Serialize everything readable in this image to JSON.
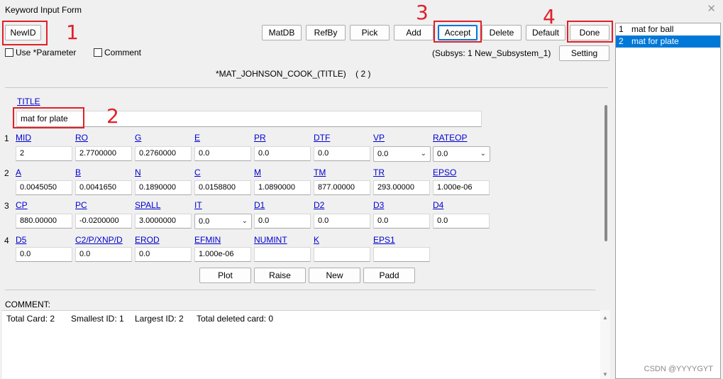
{
  "window": {
    "title": "Keyword Input Form",
    "close": "✕"
  },
  "toolbar": {
    "newid": "NewID",
    "matdb": "MatDB",
    "refby": "RefBy",
    "pick": "Pick",
    "add": "Add",
    "accept": "Accept",
    "delete": "Delete",
    "default": "Default",
    "done": "Done",
    "setting": "Setting"
  },
  "options": {
    "use_parameter": "Use *Parameter",
    "comment": "Comment"
  },
  "subsys": "(Subsys: 1 New_Subsystem_1)",
  "keyword": {
    "name": "*MAT_JOHNSON_COOK_(TITLE)",
    "count": "( 2 )"
  },
  "annotations": [
    "1",
    "2",
    "3",
    "4"
  ],
  "title_field": {
    "label": "TITLE",
    "value": "mat for plate"
  },
  "cards": [
    {
      "num": "1",
      "fields": [
        {
          "label": "MID",
          "value": "2"
        },
        {
          "label": "RO",
          "value": "2.7700000"
        },
        {
          "label": "G",
          "value": "0.2760000"
        },
        {
          "label": "E",
          "value": "0.0"
        },
        {
          "label": "PR",
          "value": "0.0"
        },
        {
          "label": "DTF",
          "value": "0.0"
        },
        {
          "label": "VP",
          "value": "0.0"
        },
        {
          "label": "RATEOP",
          "value": "0.0"
        }
      ]
    },
    {
      "num": "2",
      "fields": [
        {
          "label": "A",
          "value": "0.0045050"
        },
        {
          "label": "B",
          "value": "0.0041650"
        },
        {
          "label": "N",
          "value": "0.1890000"
        },
        {
          "label": "C",
          "value": "0.0158800"
        },
        {
          "label": "M",
          "value": "1.0890000"
        },
        {
          "label": "TM",
          "value": "877.00000"
        },
        {
          "label": "TR",
          "value": "293.00000"
        },
        {
          "label": "EPSO",
          "value": "1.000e-06"
        }
      ]
    },
    {
      "num": "3",
      "fields": [
        {
          "label": "CP",
          "value": "880.00000"
        },
        {
          "label": "PC",
          "value": "-0.0200000"
        },
        {
          "label": "SPALL",
          "value": "3.0000000"
        },
        {
          "label": "IT",
          "value": "0.0"
        },
        {
          "label": "D1",
          "value": "0.0"
        },
        {
          "label": "D2",
          "value": "0.0"
        },
        {
          "label": "D3",
          "value": "0.0"
        },
        {
          "label": "D4",
          "value": "0.0"
        }
      ]
    },
    {
      "num": "4",
      "fields": [
        {
          "label": "D5",
          "value": "0.0"
        },
        {
          "label": "C2/P/XNP/D",
          "value": "0.0"
        },
        {
          "label": "EROD",
          "value": "0.0"
        },
        {
          "label": "EFMIN",
          "value": "1.000e-06"
        },
        {
          "label": "NUMINT",
          "value": ""
        },
        {
          "label": "K",
          "value": ""
        },
        {
          "label": "EPS1",
          "value": ""
        }
      ]
    }
  ],
  "actions": {
    "plot": "Plot",
    "raise": "Raise",
    "new": "New",
    "padd": "Padd"
  },
  "comment_label": "COMMENT:",
  "stats": {
    "total": "Total Card: 2",
    "smallest": "Smallest ID: 1",
    "largest": "Largest ID: 2",
    "deleted": "Total deleted card:  0"
  },
  "list": [
    {
      "num": "1",
      "label": "mat for ball",
      "selected": false
    },
    {
      "num": "2",
      "label": "mat for plate",
      "selected": true
    }
  ],
  "watermark": "CSDN @YYYYGYT",
  "colors": {
    "annotation": "#e0202a",
    "selection": "#0078d7",
    "link": "#0000d0"
  }
}
